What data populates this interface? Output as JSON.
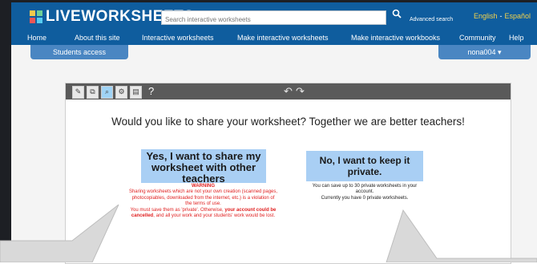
{
  "header": {
    "logo_text": "LIVEWORKSHEETS",
    "search_placeholder": "Search interactive worksheets",
    "advanced_search": "Advanced search",
    "lang_english": "English",
    "lang_separator": "-",
    "lang_spanish": "Español"
  },
  "nav": {
    "items": [
      "Home",
      "About this site",
      "Interactive worksheets",
      "Make interactive worksheets",
      "Make interactive workbooks",
      "Community",
      "Help"
    ]
  },
  "tabs": {
    "students_access": "Students access",
    "user": "nona004 ▾"
  },
  "toolbar": {
    "help": "?",
    "undo": "↶",
    "redo": "↷"
  },
  "dialog": {
    "question": "Would you like to share your worksheet? Together we are better teachers!",
    "share_button": "Yes, I want to share my worksheet with other teachers",
    "warning_title": "WARNING",
    "warning_text_1": "Sharing worksheets which are not your own creation (scanned pages, photocopiables, downloaded from the internet, etc.) is a violation of the terms of use.",
    "warning_text_2": "You must save them as 'private'. Otherwise, ",
    "warning_bold": "your account could be cancelled",
    "warning_text_3": ", and all your work and your students' work would be lost.",
    "private_button": "No, I want to keep it private.",
    "private_note_1": "You can save up to 30 private worksheets in your account.",
    "private_note_2": "Currently you have 0 private worksheets."
  },
  "colors": {
    "header_bg": "#0f5d9e",
    "tab_bg": "#4a86c2",
    "button_bg": "#a9cff4",
    "warning": "#e02020"
  }
}
